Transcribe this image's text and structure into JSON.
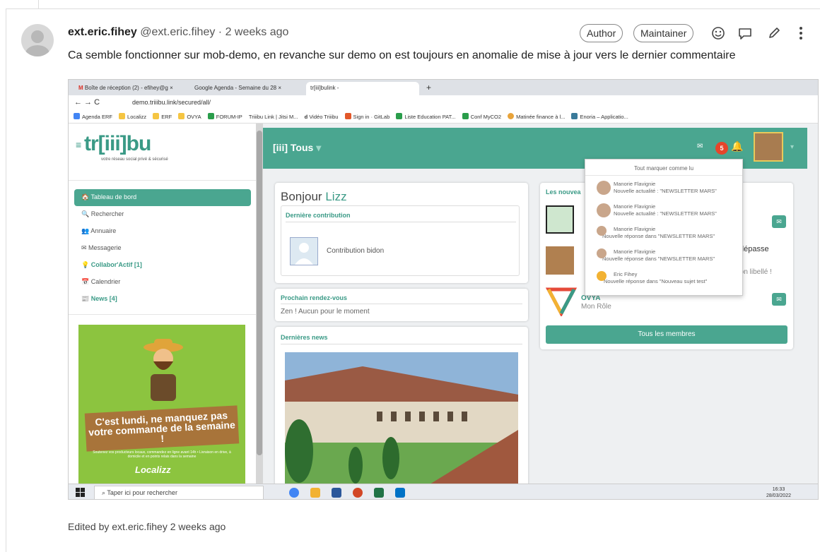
{
  "comment": {
    "author_name": "ext.eric.fihey",
    "author_handle": "@ext.eric.fihey",
    "time_ago": "· 2 weeks ago",
    "badges": [
      "Author",
      "Maintainer"
    ],
    "body": "Ca semble fonctionner sur mob-demo, en revanche sur demo on est toujours en anomalie de mise à jour vers le dernier commentaire",
    "edited": "Edited by ext.eric.fihey 2 weeks ago"
  },
  "browser": {
    "tabs": [
      "Boîte de réception (2) - efihey@g",
      "Google Agenda - Semaine du 28",
      "tr[iii]bulink -"
    ],
    "url": "demo.triiibu.link/secured/all/",
    "bookmarks": [
      "Agenda ERF",
      "Localizz",
      "ERF",
      "OVYA",
      "FORUM-IP",
      "Triiibu Link | Jitsi M...",
      "Vidéo Triiibu",
      "Sign in · GitLab",
      "Liste Education PAT...",
      "Conf MyCO2",
      "Matinée finance à l...",
      "Enoria – Applicatio..."
    ]
  },
  "app": {
    "logo": "tr[iii]bu",
    "logo_tagline": "votre réseau social privé & sécurisé",
    "nav": [
      "Tableau de bord",
      "Rechercher",
      "Annuaire",
      "Messagerie",
      "Collabor'Actif [1]",
      "Calendrier",
      "News [4]"
    ],
    "topbar_title": "[iii] Tous",
    "notif_count": "5",
    "promo_text": "C'est lundi, ne manquez pas votre commande de la semaine !",
    "promo_sub": "Soutenez vos producteurs locaux, commandez en ligne avant 14h • Livraison en drive, à domicile et en points relais dans la semaine",
    "promo_brand": "Localizz",
    "greeting_prefix": "Bonjour",
    "greeting_name": "Lizz",
    "last_contribution_title": "Dernière contribution",
    "contribution_label": "Contribution bidon",
    "next_meeting_title": "Prochain rendez-vous",
    "next_meeting_text": "Zen ! Aucun pour le moment",
    "news_title": "Dernières news",
    "members_title": "Les nouvea",
    "member_org": "OVYA",
    "member_role": "Mon Rôle",
    "member_partial_1": "dépasse",
    "member_partial_2": "s son libellé !",
    "all_members": "Tous les membres",
    "dropdown_header": "Tout marquer comme lu",
    "dropdown_items": [
      {
        "name": "Manorie Flavignie",
        "text": "Nouvelle actualité : \"NEWSLETTER MARS\""
      },
      {
        "name": "Manorie Flavignie",
        "text": "Nouvelle actualité : \"NEWSLETTER MARS\""
      },
      {
        "name": "Manorie Flavignie",
        "text": "Nouvelle réponse dans \"NEWSLETTER MARS\""
      },
      {
        "name": "Manorie Flavignie",
        "text": "Nouvelle réponse dans \"NEWSLETTER MARS\""
      },
      {
        "name": "Eric Fihey",
        "text": "Nouvelle réponse dans \"Nouveau sujet test\""
      }
    ]
  },
  "taskbar": {
    "search_placeholder": "Taper ici pour rechercher",
    "time": "16:33",
    "date": "28/03/2022"
  }
}
